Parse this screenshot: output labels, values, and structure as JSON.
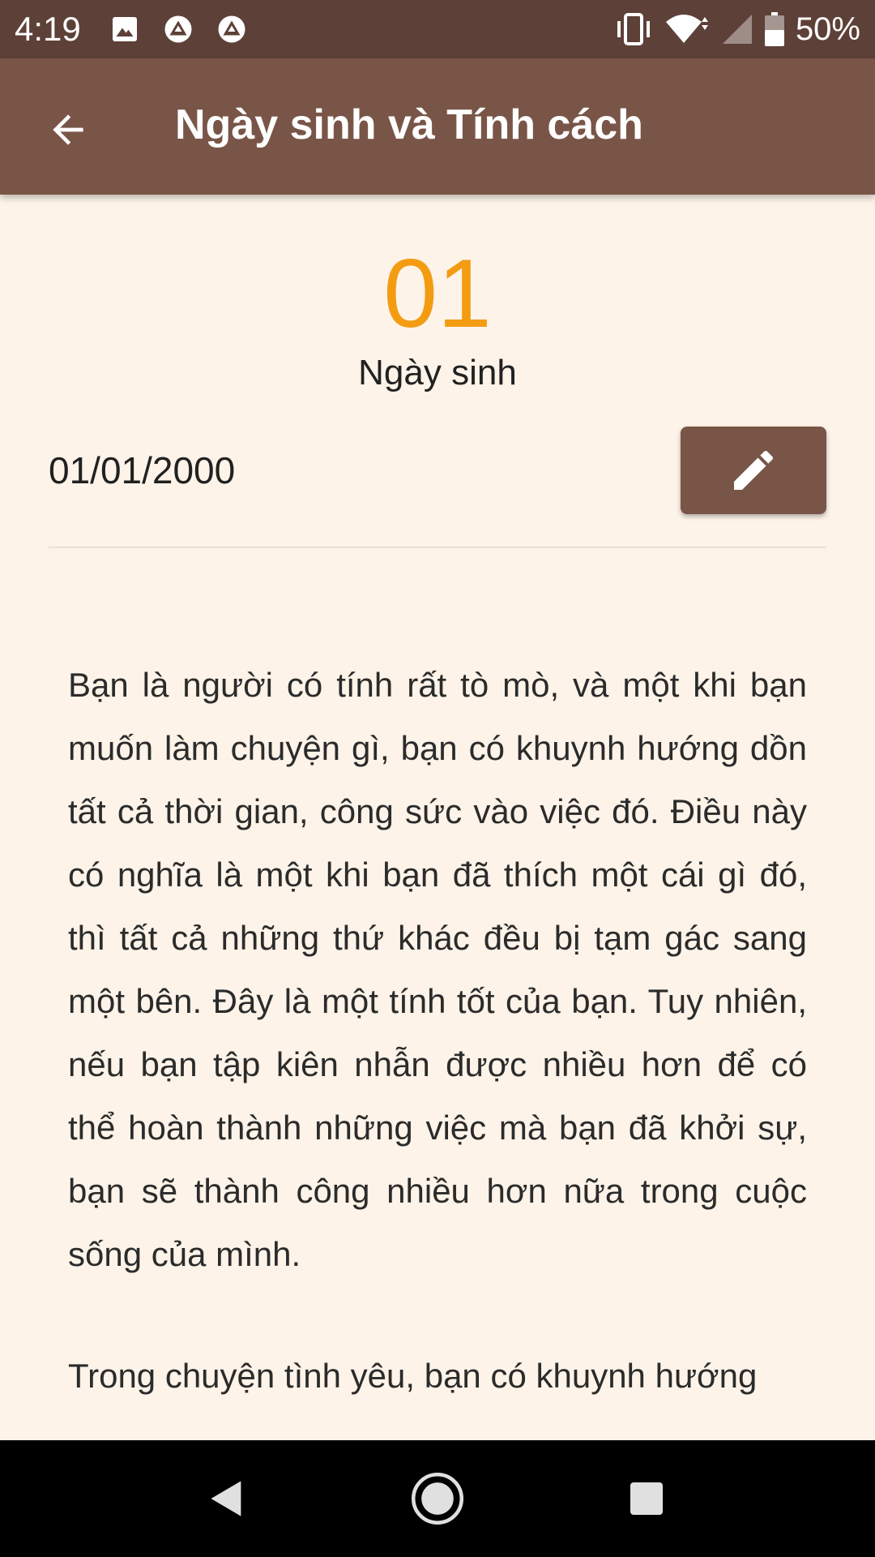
{
  "status_bar": {
    "time": "4:19",
    "battery_percent": "50%",
    "notification_icons": [
      "image-icon",
      "app-notification-icon",
      "app-notification-icon"
    ],
    "system_icons": [
      "vibrate-icon",
      "wifi-icon",
      "signal-icon",
      "battery-icon"
    ]
  },
  "app_bar": {
    "title": "Ngày sinh và Tính cách",
    "back_icon": "arrow-back-icon",
    "background_color": "#795548"
  },
  "content": {
    "day_number": "01",
    "day_label": "Ngày sinh",
    "birth_date": "01/01/2000",
    "edit_icon": "pencil-icon",
    "accent_color": "#f39c12",
    "paragraphs": [
      "Bạn là người có tính rất tò mò, và một khi bạn muốn làm chuyện gì, bạn có khuynh hướng dồn tất cả thời gian, công sức vào việc đó. Điều này có nghĩa là một khi bạn đã thích một cái gì đó, thì tất cả những thứ khác đều bị tạm gác sang một bên. Đây là một tính tốt của bạn. Tuy nhiên, nếu bạn tập kiên nhẫn được nhiều hơn để có thể hoàn thành những việc mà bạn đã khởi sự, bạn sẽ thành công nhiều hơn nữa trong cuộc sống của mình.",
      "Trong chuyện tình yêu, bạn có khuynh hướng"
    ]
  },
  "nav_bar": {
    "icons": [
      "nav-back-icon",
      "nav-home-icon",
      "nav-recents-icon"
    ]
  }
}
